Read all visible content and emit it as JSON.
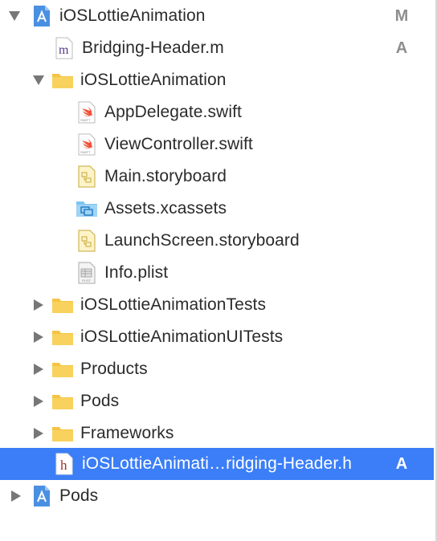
{
  "navigator": {
    "items": [
      {
        "label": "iOSLottieAnimation",
        "status": "M",
        "icon": "xcode-project-icon",
        "disclosure": "expanded"
      },
      {
        "label": "Bridging-Header.m",
        "status": "A",
        "icon": "objc-m-file-icon",
        "disclosure": "none"
      },
      {
        "label": "iOSLottieAnimation",
        "status": "",
        "icon": "folder-icon",
        "disclosure": "expanded"
      },
      {
        "label": "AppDelegate.swift",
        "status": "",
        "icon": "swift-file-icon",
        "disclosure": "none"
      },
      {
        "label": "ViewController.swift",
        "status": "",
        "icon": "swift-file-icon",
        "disclosure": "none"
      },
      {
        "label": "Main.storyboard",
        "status": "",
        "icon": "storyboard-file-icon",
        "disclosure": "none"
      },
      {
        "label": "Assets.xcassets",
        "status": "",
        "icon": "asset-catalog-icon",
        "disclosure": "none"
      },
      {
        "label": "LaunchScreen.storyboard",
        "status": "",
        "icon": "storyboard-file-icon",
        "disclosure": "none"
      },
      {
        "label": "Info.plist",
        "status": "",
        "icon": "plist-file-icon",
        "disclosure": "none"
      },
      {
        "label": "iOSLottieAnimationTests",
        "status": "",
        "icon": "folder-icon",
        "disclosure": "collapsed"
      },
      {
        "label": "iOSLottieAnimationUITests",
        "status": "",
        "icon": "folder-icon",
        "disclosure": "collapsed"
      },
      {
        "label": "Products",
        "status": "",
        "icon": "folder-icon",
        "disclosure": "collapsed"
      },
      {
        "label": "Pods",
        "status": "",
        "icon": "folder-icon",
        "disclosure": "collapsed"
      },
      {
        "label": "Frameworks",
        "status": "",
        "icon": "folder-icon",
        "disclosure": "collapsed"
      },
      {
        "label": "iOSLottieAnimati…ridging-Header.h",
        "status": "A",
        "icon": "objc-h-file-icon",
        "disclosure": "none",
        "selected": true
      },
      {
        "label": "Pods",
        "status": "",
        "icon": "xcode-project-icon",
        "disclosure": "collapsed"
      }
    ]
  },
  "colors": {
    "selection": "#3b7ef7",
    "folder": "#f5c444",
    "status_text": "#8e8e8e"
  }
}
